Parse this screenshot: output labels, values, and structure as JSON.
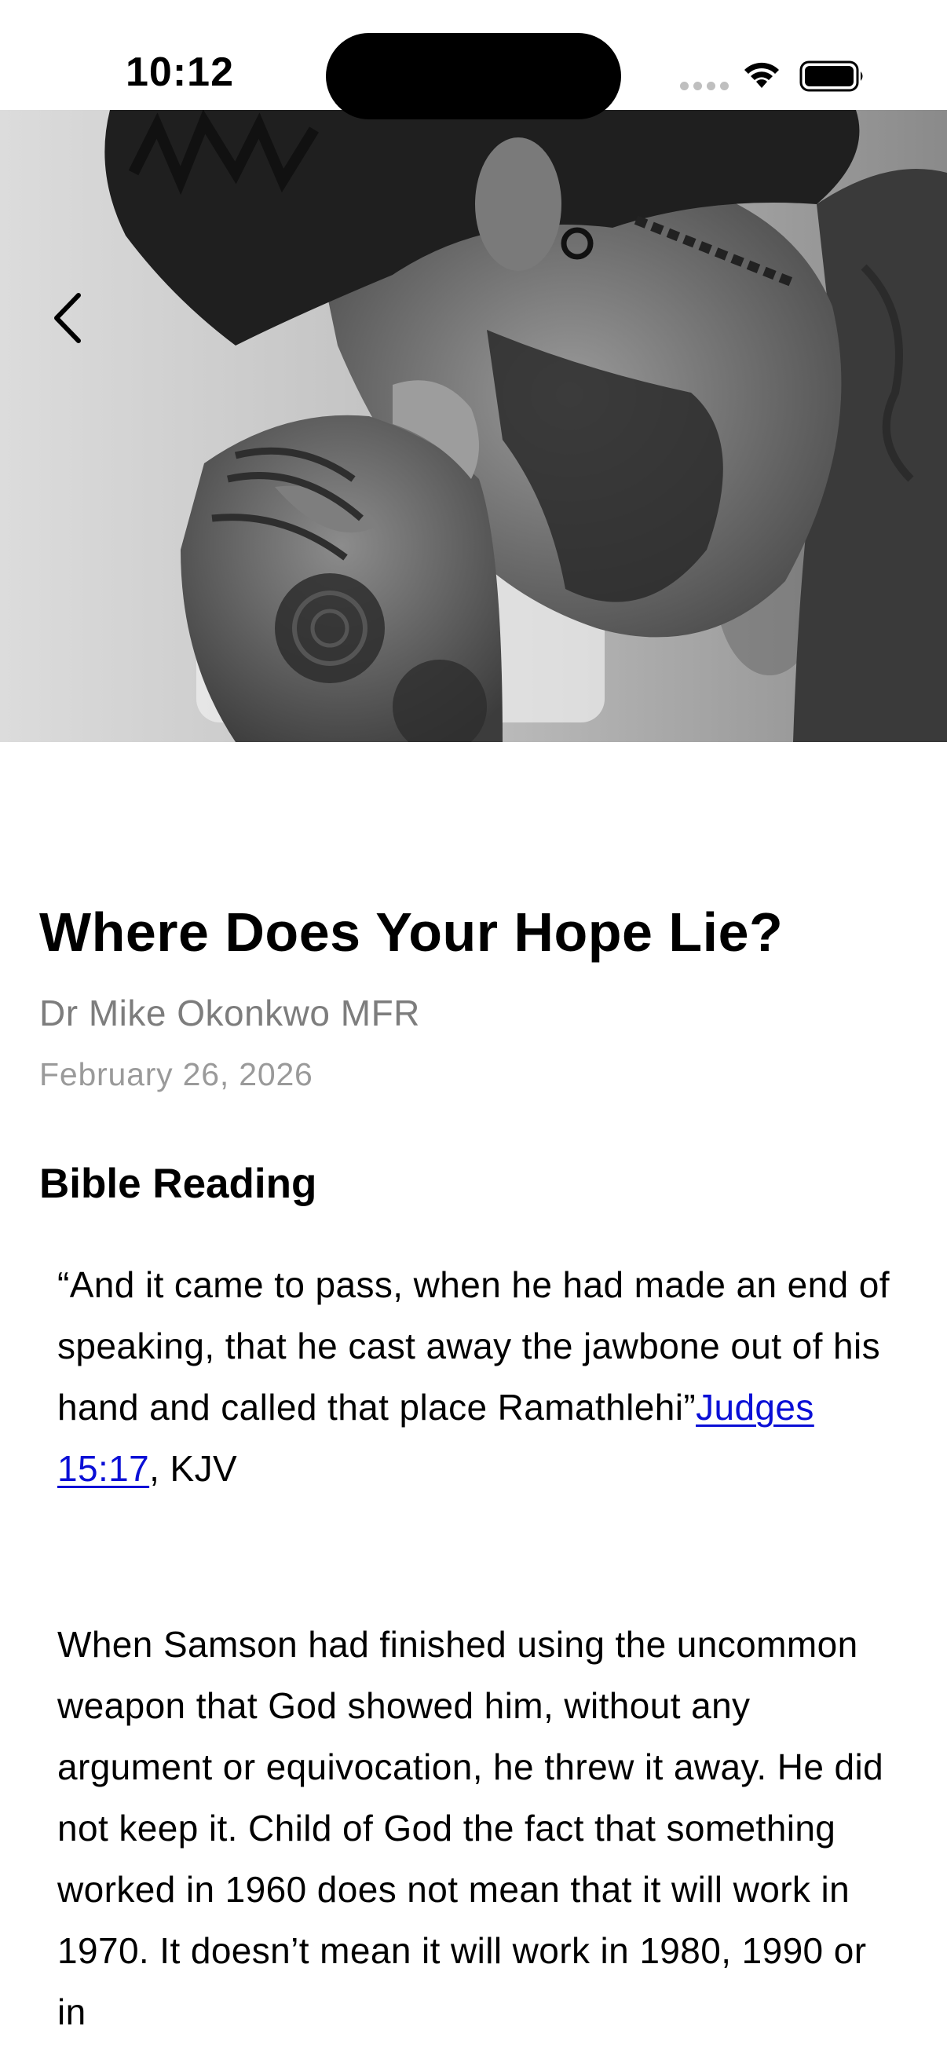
{
  "status_bar": {
    "time": "10:12"
  },
  "hero": {
    "image_icon": "praying-man-photo",
    "back_icon": "chevron-left-icon"
  },
  "article": {
    "title": "Where Does Your Hope Lie?",
    "author": "Dr Mike Okonkwo MFR",
    "date": "February 26, 2026",
    "section_heading": "Bible Reading",
    "scripture": {
      "quote": "“And it came to pass, when he had made an end of speaking, that he cast away the jawbone out of his hand and called that place Ramathlehi”",
      "reference_link": "Judges 15:17",
      "version_suffix": ", KJV",
      "link_color": "#0a0fd6"
    },
    "body": "When Samson had finished using the uncommon weapon that God showed him, without any argument or equivocation, he threw it away. He did not keep it. Child of God the fact that something worked in 1960 does not mean that it will work in 1970. It doesn’t mean it will work in 1980, 1990 or in"
  }
}
